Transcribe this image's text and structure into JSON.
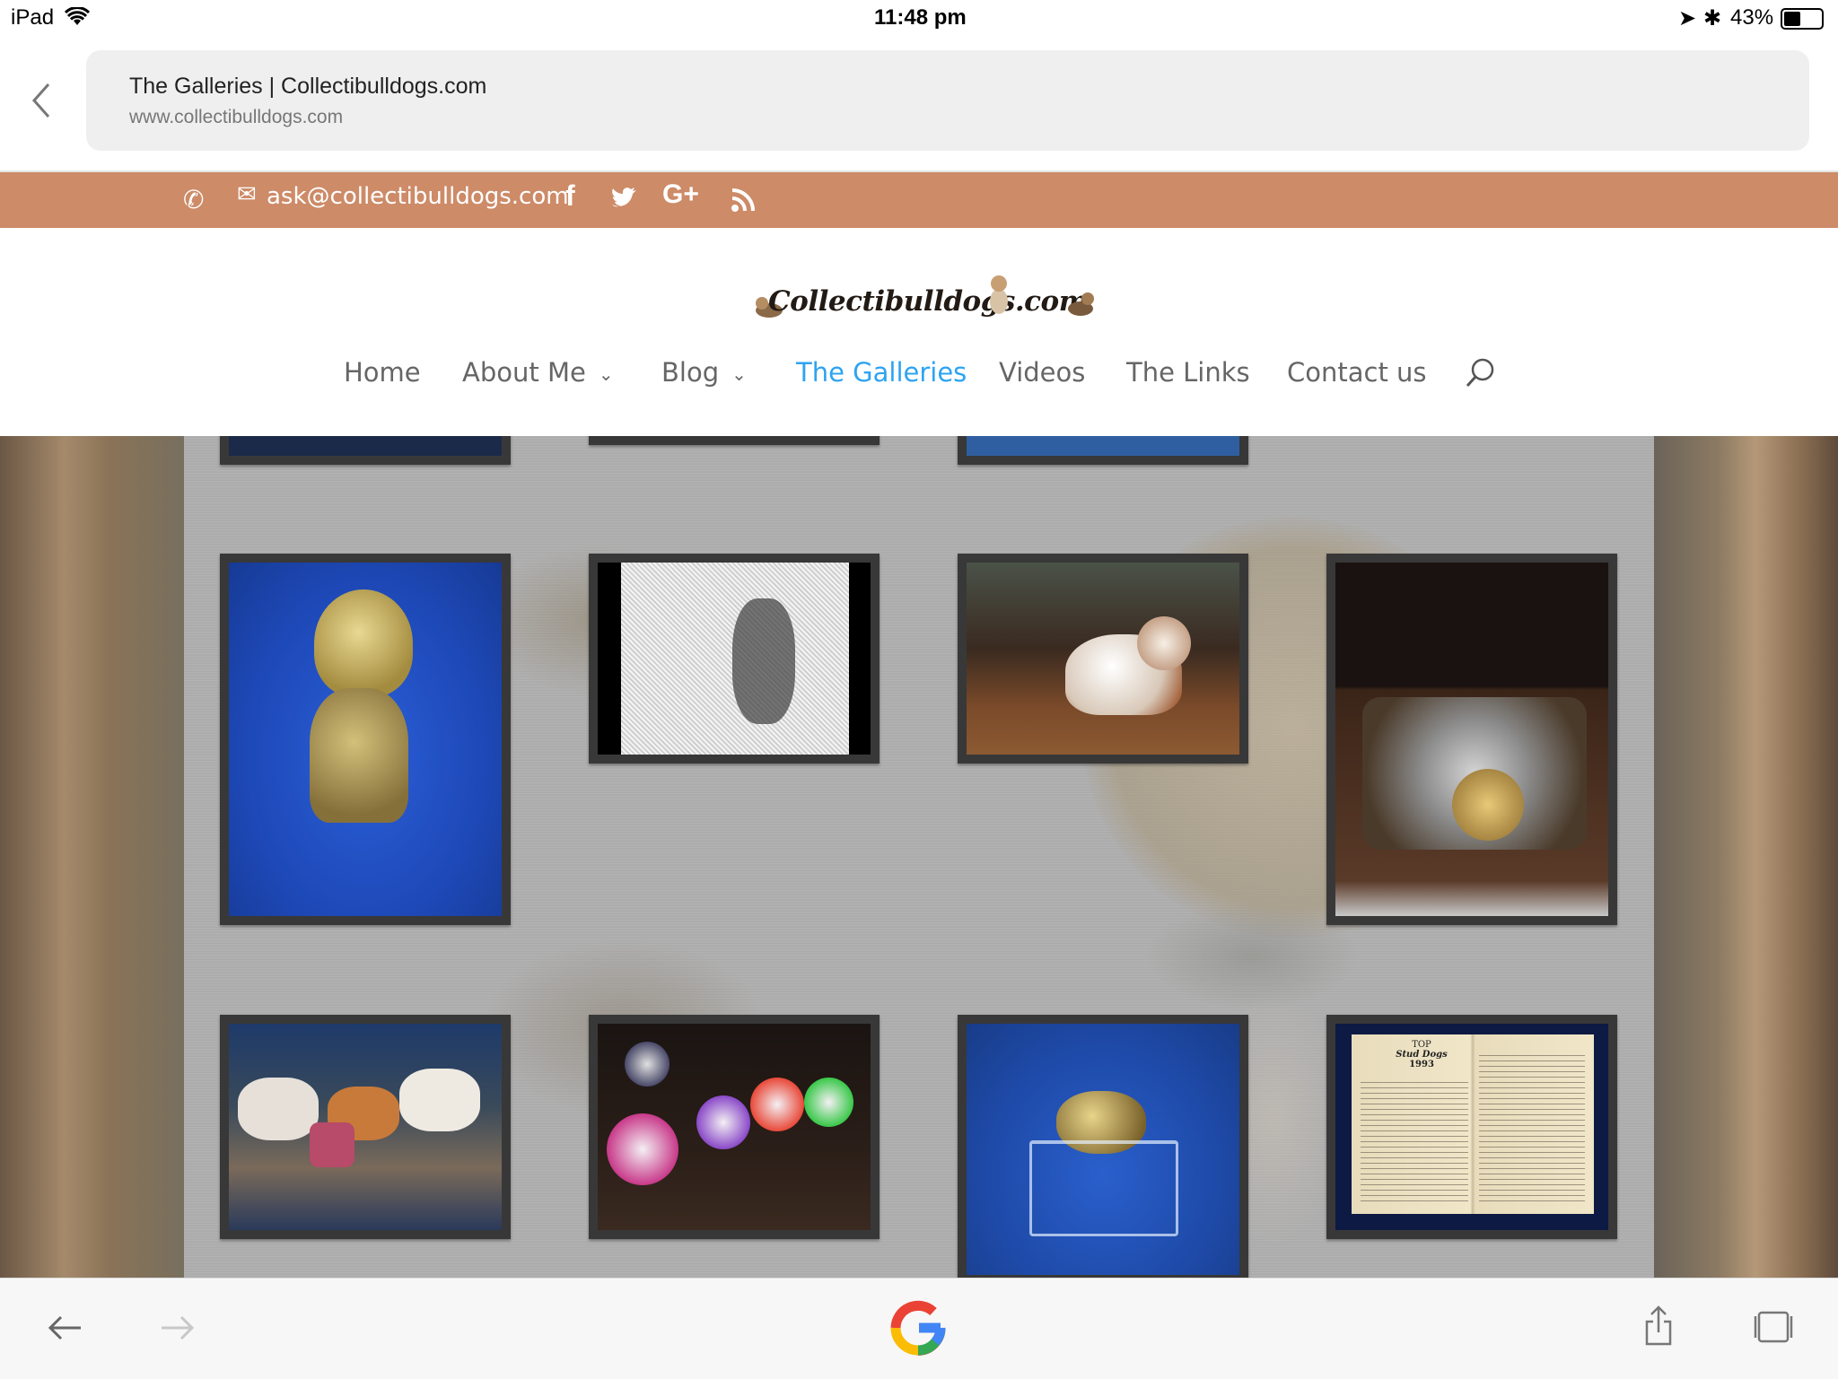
{
  "status_bar": {
    "device": "iPad",
    "time": "11:48 pm",
    "battery": "43%"
  },
  "browser": {
    "page_title": "The Galleries | Collectibulldogs.com",
    "url": "www.collectibulldogs.com"
  },
  "top_bar": {
    "email": "ask@collectibulldogs.com",
    "social": [
      "facebook-icon",
      "twitter-icon",
      "google-plus-icon",
      "rss-icon"
    ]
  },
  "site": {
    "logo_text": "Collectibulldogs.com"
  },
  "nav": {
    "items": [
      {
        "label": "Home"
      },
      {
        "label": "About Me"
      },
      {
        "label": "Blog"
      },
      {
        "label": "The Galleries"
      },
      {
        "label": "Videos"
      },
      {
        "label": "The Links"
      },
      {
        "label": "Contact us"
      }
    ],
    "active": "The Galleries"
  },
  "gallery": {
    "thumbnails": [
      {
        "name": "brass-bulldog-figurine"
      },
      {
        "name": "bulldog-engraving-print"
      },
      {
        "name": "porcelain-bulldog-in-showcase"
      },
      {
        "name": "box-of-silver-trinkets"
      },
      {
        "name": "bulldog-figurine-collection"
      },
      {
        "name": "sugar-skull-bulldog-figurines"
      },
      {
        "name": "brass-bulldog-head-on-stand"
      },
      {
        "name": "top-stud-dogs-1993-booklet"
      }
    ],
    "booklet_text": {
      "line1": "TOP",
      "line2": "Stud Dogs",
      "line3": "1993"
    }
  },
  "colors": {
    "accent": "#2ea3f2",
    "topbar": "#cd8b68",
    "nav_text": "#666666"
  }
}
